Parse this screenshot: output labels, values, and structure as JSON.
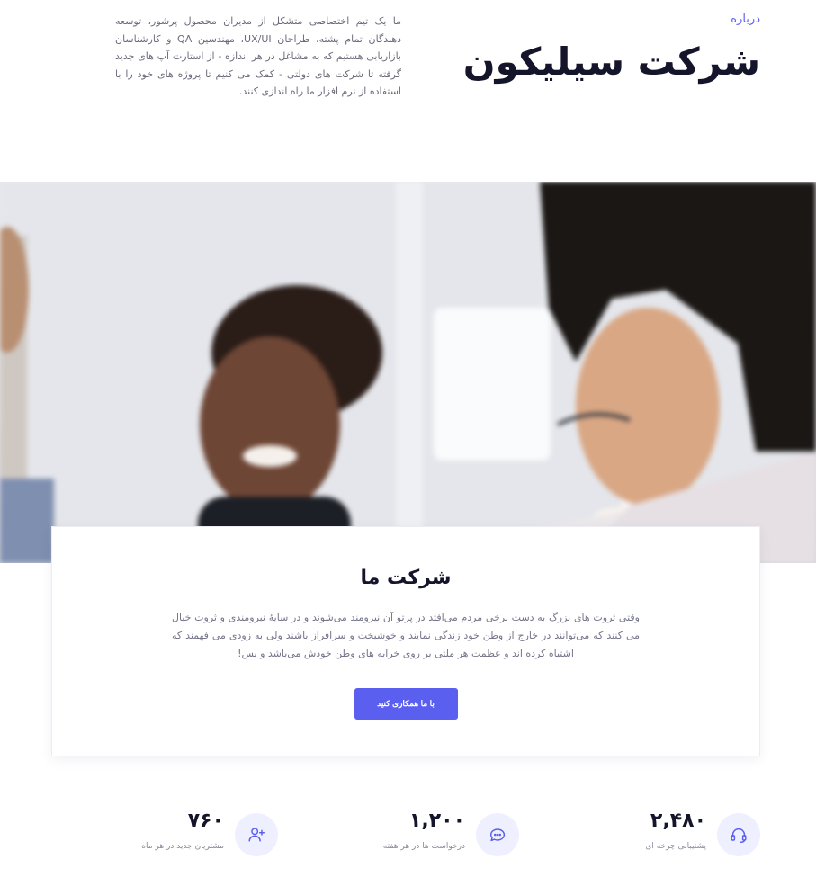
{
  "header": {
    "about_label": "درباره",
    "company_title": "شرکت سیلیکون",
    "intro_text": "ما یک تیم اختصاصی متشکل از مدیران محصول پرشور، توسعه دهندگان تمام پشته، طراحان UX/UI، مهندسین QA و کارشناسان بازاریابی هستیم که به مشاغل در هر اندازه - از استارت آپ های جدید گرفته تا شرکت های دولتی - کمک می کنیم تا پروژه های خود را با استفاده از نرم افزار ما راه اندازی کنند."
  },
  "card": {
    "title": "شرکت ما",
    "text": "وقتی ثروت های بزرگ به دست برخی مردم می‌افتد در پرتو آن نیرومند می‌شوند و در سایهٔ نیرومندی و ثروت خیال می کنند که می‌توانند در خارج از وطن خود زندگی نمایند و خوشبخت و سرافراز باشند ولی به زودی می فهمند که اشتباه کرده اند و عظمت هر ملتی بر روی خرابه های وطن خودش می‌باشد و بس!",
    "button_label": "با ما همکاری کنید"
  },
  "stats": [
    {
      "icon": "headset-icon",
      "value": "۲,۴۸۰",
      "label": "پشتیبانی چرخه ای"
    },
    {
      "icon": "chat-support-icon",
      "value": "۱,۲۰۰",
      "label": "درخواست ها در هر هفته"
    },
    {
      "icon": "add-user-icon",
      "value": "۷۶۰",
      "label": "مشتریان جدید در هر ماه"
    }
  ],
  "colors": {
    "accent": "#5b5ff0",
    "title": "#14142b",
    "muted_text": "#74748a",
    "icon_bg": "#eef0ff"
  }
}
